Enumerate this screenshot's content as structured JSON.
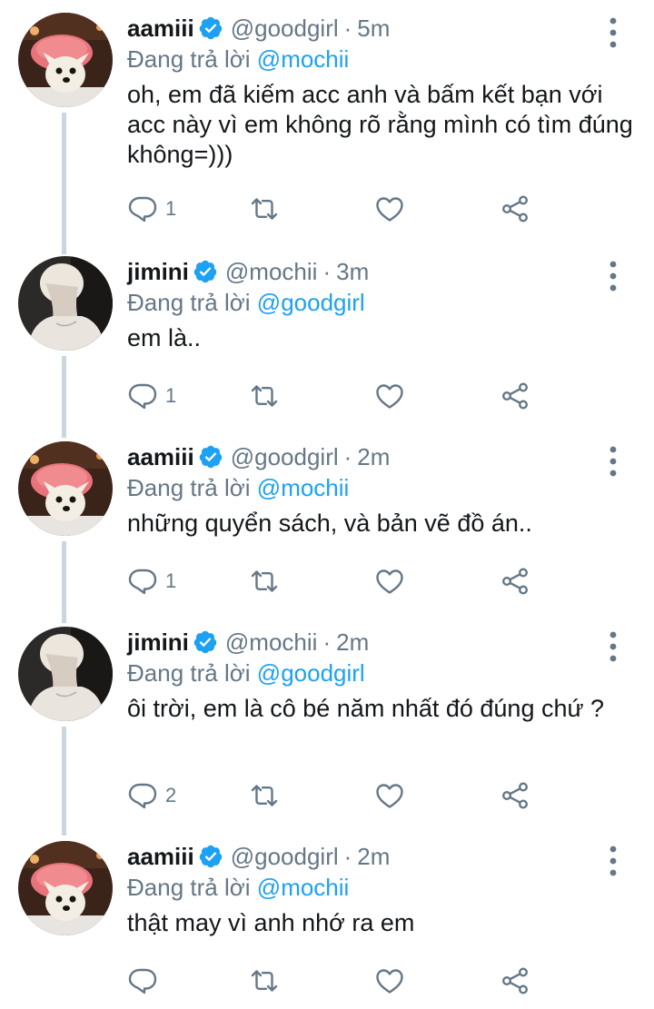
{
  "reply_prefix": "Đang trả lời",
  "tweets": [
    {
      "name": "aamiii",
      "handle": "@goodgirl",
      "time": "5m",
      "reply_to": "@mochii",
      "text": "oh, em đã kiếm acc anh và bấm kết bạn với acc này vì em không rõ rằng mình có tìm đúng không=)))",
      "replies": "1",
      "avatar": "dog-avatar"
    },
    {
      "name": "jimini",
      "handle": "@mochii",
      "time": "3m",
      "reply_to": "@goodgirl",
      "text": "em là..",
      "replies": "1",
      "avatar": "person-avatar"
    },
    {
      "name": "aamiii",
      "handle": "@goodgirl",
      "time": "2m",
      "reply_to": "@mochii",
      "text": "những quyển sách, và bản vẽ đồ án..",
      "replies": "1",
      "avatar": "dog-avatar"
    },
    {
      "name": "jimini",
      "handle": "@mochii",
      "time": "2m",
      "reply_to": "@goodgirl",
      "text": "ôi trời, em là cô bé năm nhất đó đúng chứ ?",
      "replies": "2",
      "avatar": "person-avatar"
    },
    {
      "name": "aamiii",
      "handle": "@goodgirl",
      "time": "2m",
      "reply_to": "@mochii",
      "text": "thật may vì anh nhớ ra em",
      "replies": "",
      "avatar": "dog-avatar"
    }
  ],
  "colors": {
    "accent": "#1da1f2",
    "secondary_text": "#657786",
    "primary_text": "#14171a",
    "thread_line": "#ccd6dd"
  }
}
